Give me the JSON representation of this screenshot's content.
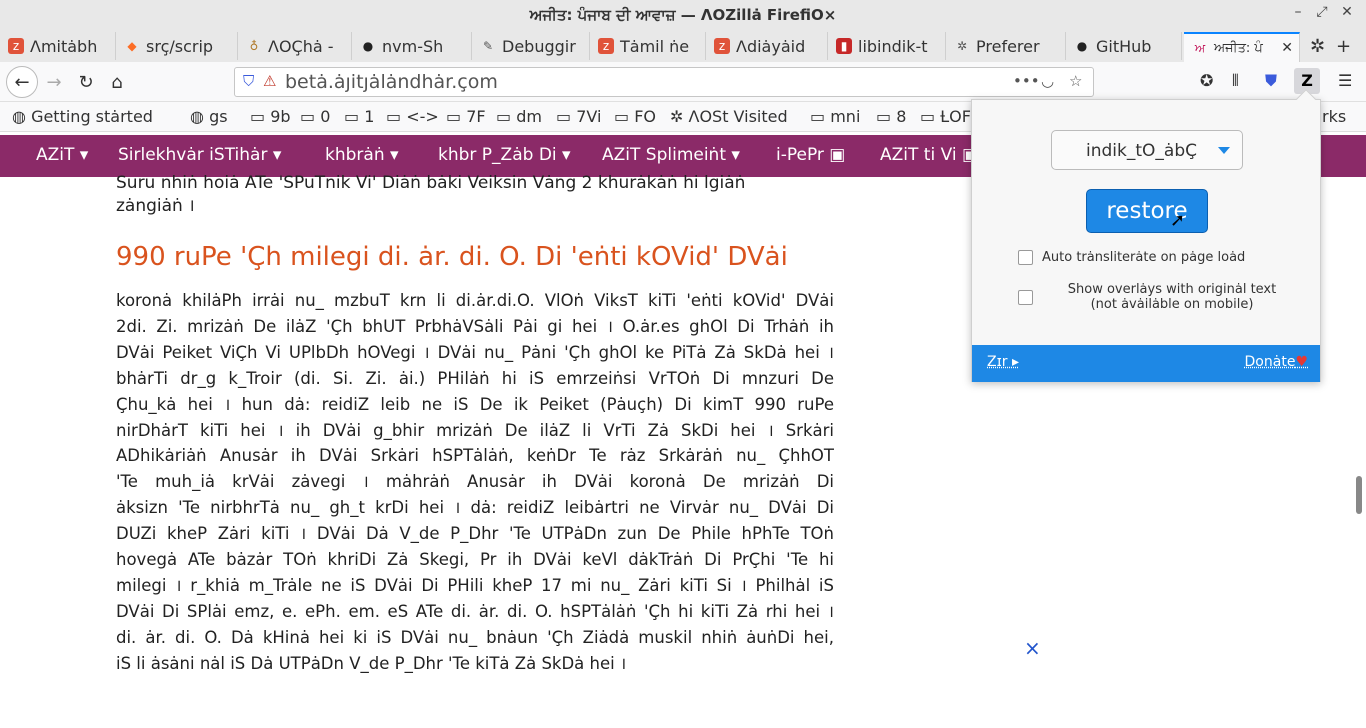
{
  "window": {
    "title": "ਅਜੀਤ: ਪੰਜਾਬ ਦੀ ਆਵਾਜ਼ — ΛOZillȧ FirefiO×",
    "controls": [
      "–",
      "⤢",
      "✕"
    ]
  },
  "tabs": [
    {
      "label": "Λmitȧbh",
      "icon": "zee-icon",
      "color": "#e0533a"
    },
    {
      "label": "srç/scrip",
      "icon": "gitlab-icon",
      "color": "#fc6d26"
    },
    {
      "label": "ΛOÇhȧ -",
      "icon": "bottle-icon",
      "color": "#b07a2a"
    },
    {
      "label": "nvm-Sh",
      "icon": "github-icon",
      "color": "#222"
    },
    {
      "label": "Debuggir",
      "icon": "wrench-icon",
      "color": "#555"
    },
    {
      "label": "Tȧmil ṅe",
      "icon": "zee-icon",
      "color": "#e0533a"
    },
    {
      "label": "Λdiȧyȧid",
      "icon": "zee-icon",
      "color": "#e0533a"
    },
    {
      "label": "libindik-t",
      "icon": "box-icon",
      "color": "#c62828"
    },
    {
      "label": "Preferer",
      "icon": "gear-icon",
      "color": "#555"
    },
    {
      "label": "GitHub",
      "icon": "github-icon",
      "color": "#222"
    },
    {
      "label": "ਅਜੀਤ: ਪੰ",
      "icon": "ajit-icon",
      "color": "#c2185b"
    }
  ],
  "nav": {
    "url": "betȧ.ȧȷitȷȧlȧndhȧr.çom",
    "back": "←",
    "forward": "→",
    "reload": "↻",
    "home": "⌂"
  },
  "bookmarks": [
    {
      "label": "Getting stȧrted",
      "icon": "globe-icon"
    },
    {
      "label": "gs",
      "icon": "globe-icon"
    },
    {
      "label": "9b",
      "icon": "folder-icon"
    },
    {
      "label": "0",
      "icon": "folder-icon"
    },
    {
      "label": "1",
      "icon": "folder-icon"
    },
    {
      "label": "<->",
      "icon": "folder-icon"
    },
    {
      "label": "7F",
      "icon": "folder-icon"
    },
    {
      "label": "dm",
      "icon": "folder-icon"
    },
    {
      "label": "7Vi",
      "icon": "folder-icon"
    },
    {
      "label": "FO",
      "icon": "folder-icon"
    },
    {
      "label": "ΛOSt Visited",
      "icon": "gear-icon"
    },
    {
      "label": "mni",
      "icon": "folder-icon"
    },
    {
      "label": "8",
      "icon": "folder-icon"
    },
    {
      "label": "ȽOF",
      "icon": "folder-icon"
    },
    {
      "label": "rks",
      "icon": "folder-icon"
    }
  ],
  "sitenav": [
    "AZiT ▾",
    "Sirlekhvȧr iSTihȧr ▾",
    "khbrȧṅ ▾",
    "khbr P_Zȧb Di ▾",
    "AZiT Splimeiṅt ▾",
    "i-PePr ▣",
    "AZiT ti Vi ▣"
  ],
  "article": {
    "prev_line1": "Suru nhiṅ hoiȧ ATe 'SPuTnik Vi' Diȧṅ bȧki Veiksin Vȧng 2 khurȧkȧṅ hi lgiȧṅ",
    "prev_line2": "zȧngiȧṅ ।",
    "headline": "990 ruPe 'Çh milegi di. ȧr. di. O. Di 'eṅti kOVid' DVȧi",
    "body_lines": [
      "koronȧ khilȧPh irrȧi nu_ mzbuT krn li di.ȧr.di.O. VlOṅ ViksT kiTi 'eṅti kOVid' DVȧi",
      "2di. Zi. mrizȧṅ De ilȧZ 'Çh bhUT PrbhȧVSȧli Pȧi gi hei । O.ȧr.es ghOl Di Trhȧṅ ih",
      "DVȧi Peiket ViÇh Vi UPlbDh hOVegi । DVȧi nu_ Pȧni 'Çh ghOl ke PiTȧ Zȧ SkDȧ hei ।",
      "bhȧrTi dr_g k_Troir (di. Si. Zi. ȧi.) PHilȧṅ hi iS emrzeiṅsi VrTOṅ Di mnzuri De",
      "Çhu_kȧ hei । hun dȧ: reidiZ leib ne iS De ik Peiket (Pȧuçh) Di kimT 990 ruPe",
      "nirDhȧrT kiTi hei । ih DVȧi g_bhir mrizȧṅ De ilȧZ li VrTi Zȧ SkDi hei । Srkȧri",
      "ADhikȧriȧṅ Anusȧr ih DVȧi Srkȧri hSPTȧlȧṅ, keṅDr Te rȧz Srkȧrȧṅ nu_ ÇhhOT",
      "'Te muh_iȧ krVȧi zȧvegi । mȧhrȧṅ Anusȧr ih DVȧi koronȧ De mrizȧṅ Di",
      "ȧksizn 'Te nirbhrTȧ nu_ gh_t krDi hei । dȧ: reidiZ leibȧrtri ne Virvȧr nu_ DVȧi Di",
      "DUZi kheP Zȧri kiTi । DVȧi Dȧ V_de P_Dhr 'Te UTPȧDn zun De Phile hPhTe TOṅ",
      "hovegȧ ATe bȧzȧr TOṅ khriDi Zȧ Skegi, Pr ih DVȧi keVl dȧkTrȧṅ Di PrÇhi 'Te hi",
      "milegi । r_khiȧ m_Trȧle ne iS DVȧi Di PHili kheP 17 mi nu_ Zȧri kiTi Si । Philhȧl iS",
      "DVȧi Di SPlȧi emz, e. ePh. em. eS ATe di. ȧr. di. O. hSPTȧlȧṅ 'Çh hi kiTi Zȧ rhi hei ।",
      "di. ȧr. di. O. Dȧ kHinȧ hei ki iS DVȧi nu_ bnȧun 'Çh Ziȧdȧ muskil nhiṅ ȧuṅDi hei,",
      "iS li ȧsȧni nȧl iS Dȧ UTPȧDn V_de P_Dhr 'Te kiTȧ Zȧ SkDȧ hei ।"
    ],
    "close_mark": "×"
  },
  "popup": {
    "select_value": "indik_tO_ȧbÇ",
    "restore_label": "restore",
    "auto_label": "Auto trȧnsliterȧte on pȧge loȧd",
    "overlay_label_1": "Show overlȧys with originȧl text",
    "overlay_label_2": "(not ȧvȧilȧble on mobile)",
    "footer_left": "Zɪr ▸",
    "footer_right": "Donȧte",
    "heart": "♥",
    "accent": "#1e88e5"
  }
}
